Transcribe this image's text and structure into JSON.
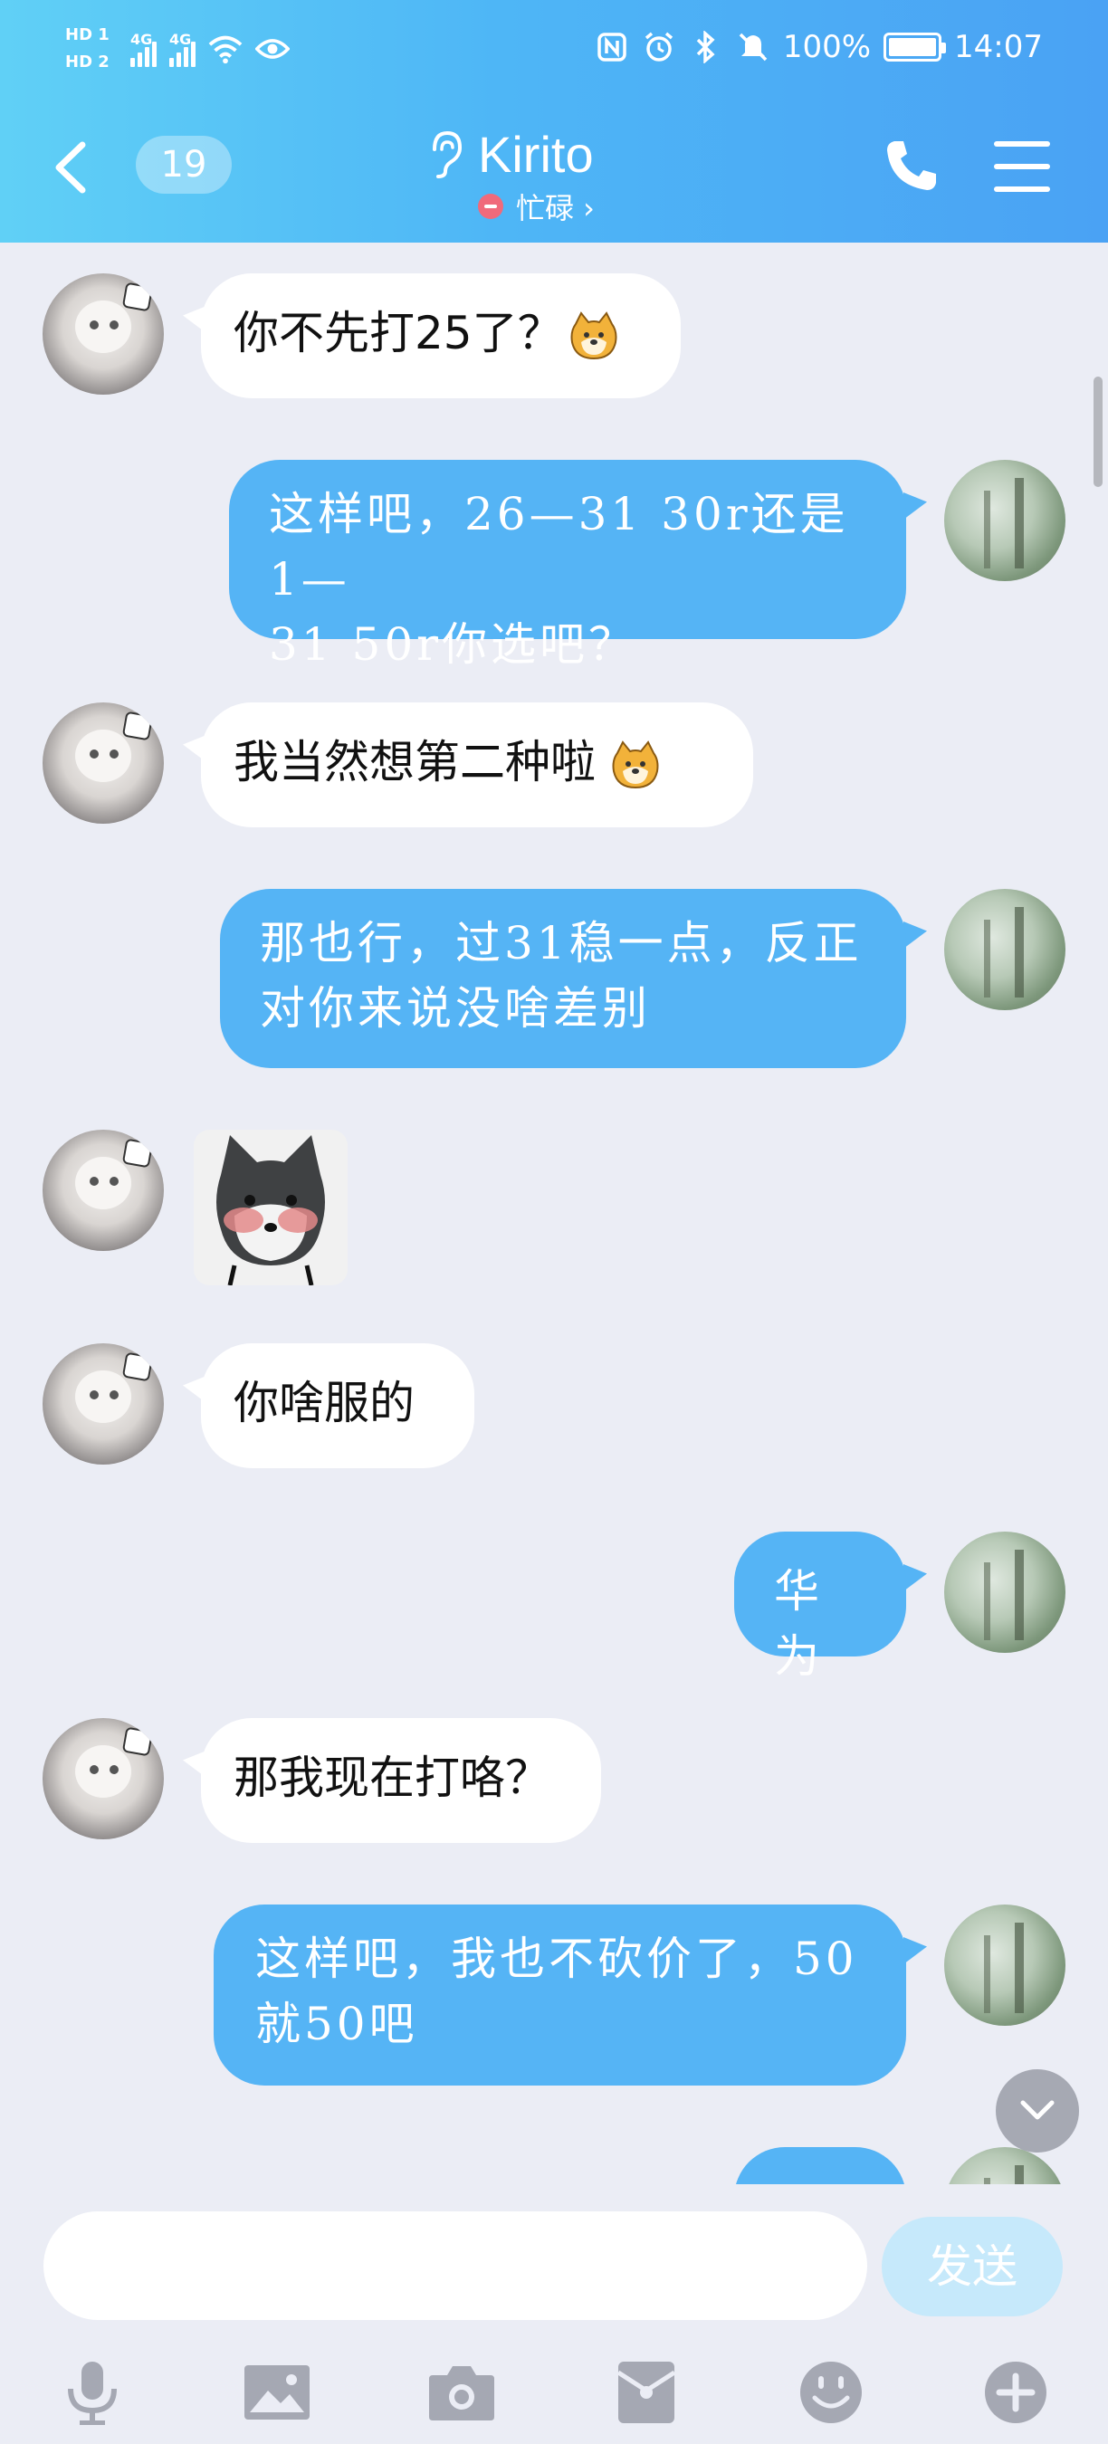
{
  "status_bar": {
    "hd1": "HD 1",
    "hd2": "HD 2",
    "net1": "4G",
    "net2": "4G",
    "wifi_tag": "6",
    "battery": "100%",
    "time": "14:07"
  },
  "header": {
    "unread_count": "19",
    "contact_name": "Kirito",
    "status_text": "忙碌 ›"
  },
  "messages": [
    {
      "from": "contact",
      "text": "你不先打25了？",
      "emoji": "shiba-face"
    },
    {
      "from": "me",
      "line1": "这样吧，26—31 30r还是1—",
      "line2": "31 50r你选吧？"
    },
    {
      "from": "contact",
      "text": "我当然想第二种啦",
      "emoji": "shiba-face"
    },
    {
      "from": "me",
      "line1": "那也行，过31稳一点，反正",
      "line2": "对你来说没啥差别"
    },
    {
      "from": "contact",
      "sticker": "blushing-shiba-sticker"
    },
    {
      "from": "contact",
      "text": "你啥服的"
    },
    {
      "from": "me",
      "text": "华为"
    },
    {
      "from": "contact",
      "text": "那我现在打咯？"
    },
    {
      "from": "me",
      "line1": "这样吧，我也不砍价了，50",
      "line2": "就50吧"
    }
  ],
  "composer": {
    "input_value": "",
    "send_label": "发送"
  },
  "toolbar": [
    "voice",
    "image",
    "camera",
    "red-packet",
    "emoji",
    "more"
  ]
}
